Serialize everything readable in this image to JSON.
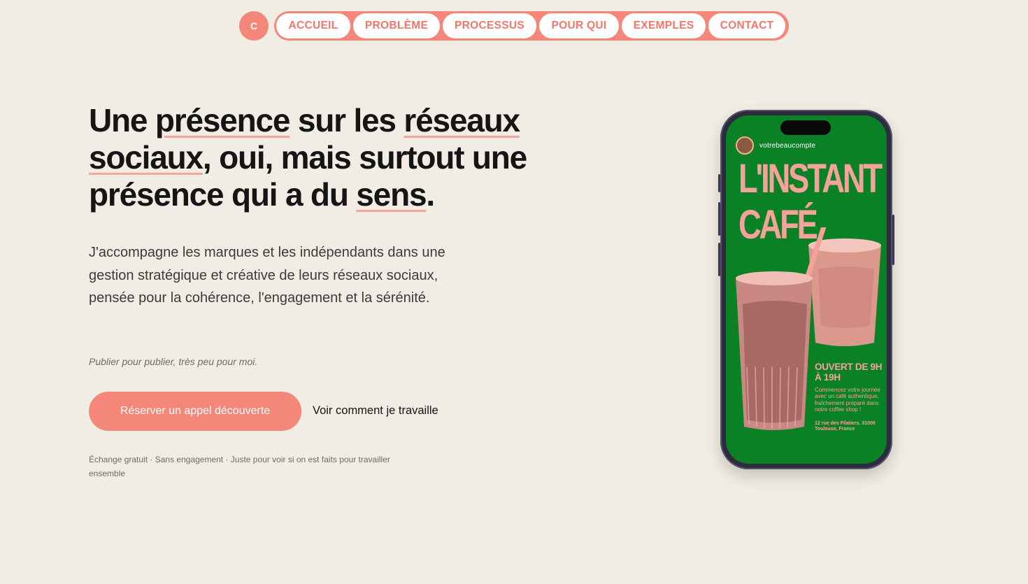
{
  "nav": {
    "logo_letter": "C",
    "items": [
      {
        "label": "ACCUEIL"
      },
      {
        "label": "PROBLÈME"
      },
      {
        "label": "PROCESSUS"
      },
      {
        "label": "POUR QUI"
      },
      {
        "label": "EXEMPLES"
      },
      {
        "label": "CONTACT"
      }
    ]
  },
  "hero": {
    "headline": {
      "part1": "Une ",
      "hl1": "présence",
      "part2": " sur les ",
      "hl2": "réseaux sociaux",
      "part3": ", oui, mais surtout une présence qui a du ",
      "hl3": "sens",
      "part4": "."
    },
    "intro": "J'accompagne les marques et les indépendants dans une gestion stratégique et créative de leurs réseaux sociaux, pensée pour la cohérence, l'engagement et la sérénité.",
    "tagline": "Publier pour publier, très peu pour moi.",
    "cta_label": "Réserver un appel découverte",
    "secondary_label": "Voir comment je travaille",
    "fineprint": "Échange gratuit · Sans engagement · Juste pour voir si on est faits pour travailler ensemble"
  },
  "phone_post": {
    "username": "votrebeaucompte",
    "title_line1": "L'INSTANT",
    "title_line2": "CAFÉ",
    "hours": "OUVERT DE 9H À 19H",
    "promo": "Commencez votre journée avec un café authentique, fraîchement préparé dans notre coffee shop !",
    "address": "12 rue des Filatiers, 31000 Toulouse, France"
  },
  "colors": {
    "background": "#f1ede4",
    "accent": "#f4877a",
    "post_green": "#0b8126",
    "post_pink": "#f4a29a"
  }
}
